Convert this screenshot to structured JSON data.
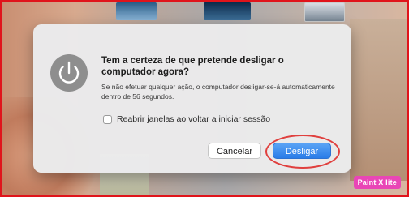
{
  "dialog": {
    "title": "Tem a certeza de que pretende desligar o computador agora?",
    "message": "Se não efetuar qualquer ação, o computador desligar-se-á automaticamente dentro de 56 segundos.",
    "reopen_label": "Reabrir janelas ao voltar a iniciar sessão",
    "reopen_checked": false,
    "cancel_label": "Cancelar",
    "shutdown_label": "Desligar",
    "icon": "power-icon"
  },
  "watermark": {
    "text": "Paint X lite"
  },
  "colors": {
    "annotation_border": "#e0141b",
    "primary_button": "#2a7de8",
    "watermark_bg": "#e946b6"
  }
}
